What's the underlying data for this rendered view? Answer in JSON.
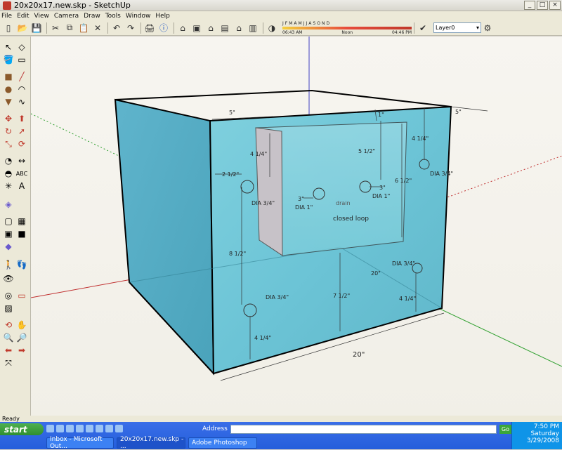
{
  "window": {
    "title": "20x20x17.new.skp - SketchUp",
    "min": "_",
    "max": "□",
    "close": "×"
  },
  "menu": [
    "File",
    "Edit",
    "View",
    "Camera",
    "Draw",
    "Tools",
    "Window",
    "Help"
  ],
  "toolbar": {
    "icons": [
      "new-icon",
      "open-icon",
      "save-icon",
      "cut-icon",
      "copy-icon",
      "paste-icon",
      "erase-icon",
      "undo-icon",
      "redo-icon",
      "print-icon",
      "model-info-icon",
      "iso-icon",
      "top-icon",
      "front-icon",
      "right-icon",
      "back-icon",
      "left-icon"
    ],
    "months": [
      "J",
      "F",
      "M",
      "A",
      "M",
      "J",
      "J",
      "A",
      "S",
      "O",
      "N",
      "D"
    ],
    "time_start": "06:43 AM",
    "time_mid": "Noon",
    "time_end": "04:46 PM",
    "layer": "Layer0"
  },
  "status": {
    "text": "Ready"
  },
  "taskbar": {
    "start_label": "start",
    "address_label": "Address",
    "address_value": "",
    "go_label": "Go",
    "tasks": [
      "Inbox - Microsoft Out...",
      "20x20x17.new.skp - ...",
      "Adobe Photoshop"
    ],
    "clock": "7:50 PM",
    "day": "Saturday",
    "date": "3/29/2008"
  },
  "model": {
    "dims": {
      "top_w": "5\"",
      "top_r": "5\"",
      "d1": "1\"",
      "d_41_4_a": "4 1/4\"",
      "d_5_1_2": "5 1/2\"",
      "d_41_4_b": "4 1/4\"",
      "d_21_2": "2 1/2\"",
      "d_3_a": "3\"",
      "d_3_b": "3\"",
      "d_61_2": "6 1/2\"",
      "d_81_2": "8 1/2\"",
      "d_71_2": "7 1/2\"",
      "d_41_4_c": "4 1/4\"",
      "d_41_4_d": "4 1/4\"",
      "d_20_bottom": "20\"",
      "d_20_side": "20\""
    },
    "labels": {
      "dia34_a": "DIA 3/4\"",
      "dia1_a": "DIA 1\"",
      "dia1_b": "DIA 1\"",
      "dia34_b": "DIA 3/4\"",
      "dia34_c": "DIA 3/4\"",
      "dia34_d": "DIA 3/4\"",
      "drain": "drain",
      "closed_loop": "closed loop"
    }
  }
}
